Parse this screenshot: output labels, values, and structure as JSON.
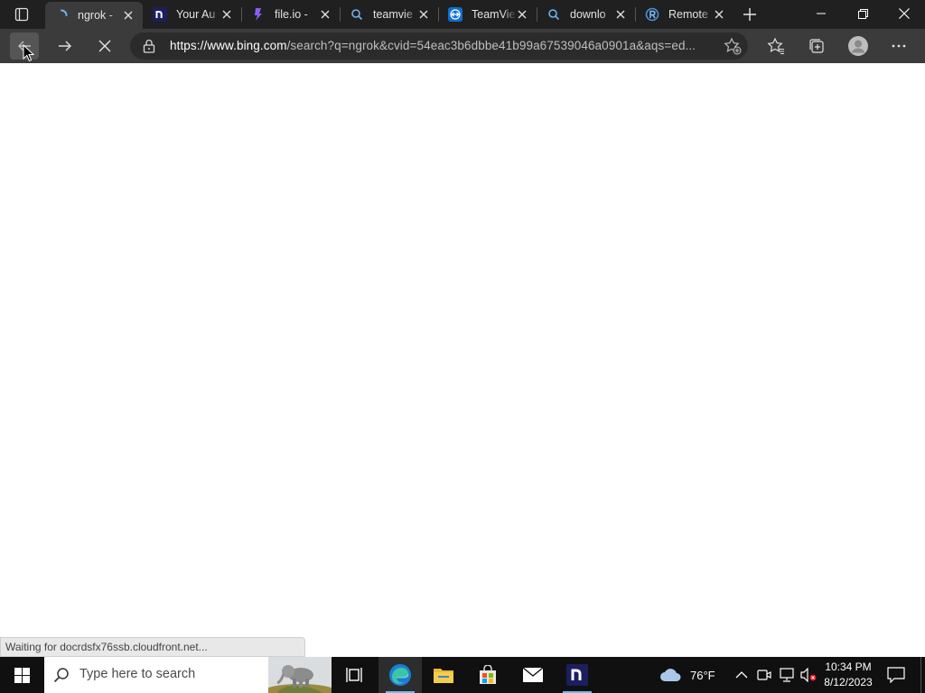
{
  "browser": {
    "tabs": [
      {
        "title": "ngrok -",
        "icon": "loading-spinner-icon",
        "active": true
      },
      {
        "title": "Your Au",
        "icon": "notion-n-icon",
        "active": false
      },
      {
        "title": "file.io -",
        "icon": "file-io-icon",
        "active": false
      },
      {
        "title": "teamvie",
        "icon": "search-icon",
        "active": false
      },
      {
        "title": "TeamVie",
        "icon": "teamviewer-icon",
        "active": false
      },
      {
        "title": "downlo",
        "icon": "search-icon",
        "active": false
      },
      {
        "title": "Remote",
        "icon": "remote-r-icon",
        "active": false
      }
    ],
    "address": {
      "host": "https://www.bing.com",
      "rest": "/search?q=ngrok&cvid=54eac3b6dbbe41b99a67539046a0901a&aqs=ed..."
    },
    "status_text": "Waiting for docrdsfx76ssb.cloudfront.net..."
  },
  "taskbar": {
    "search_placeholder": "Type here to search",
    "weather": "76°F",
    "time": "10:34 PM",
    "date": "8/12/2023"
  },
  "colors": {
    "tabstrip_bg": "#202020",
    "toolbar_bg": "#3b3b3b",
    "taskbar_bg": "#101010",
    "accent": "#76b9ed"
  }
}
